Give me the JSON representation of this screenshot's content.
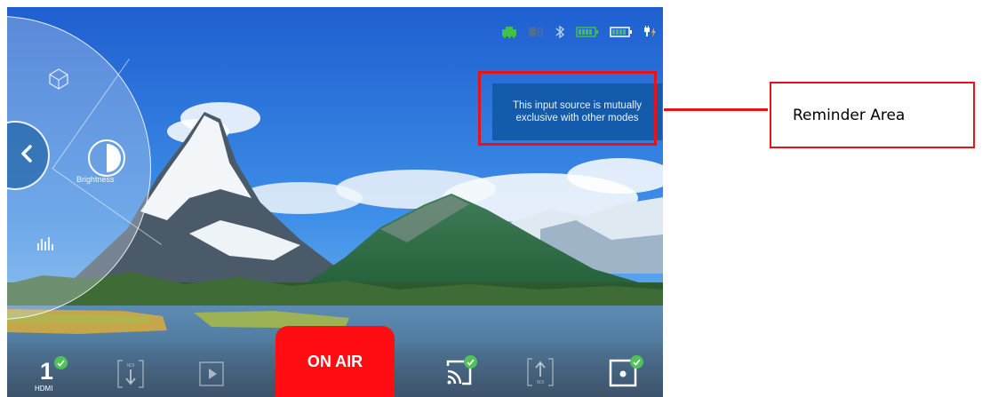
{
  "reminder": {
    "line1": "This input source is mutually",
    "line2": "exclusive with other modes"
  },
  "callout_label": "Reminder Area",
  "radial_menu": {
    "brightness_label": "Brightness"
  },
  "bottom_bar": {
    "source_number": "1",
    "source_label": "HDMI",
    "on_air_label": "ON AIR",
    "ndi_label": "NDI"
  },
  "status_icons": [
    "ethernet-icon",
    "sim-card-icon",
    "bluetooth-icon",
    "battery-icon",
    "battery-icon",
    "charging-icon"
  ],
  "colors": {
    "on_air": "#ff0d12",
    "reminder_bg": "#1258a5",
    "annotation": "#e8121b",
    "status_green": "#3fc24a"
  }
}
